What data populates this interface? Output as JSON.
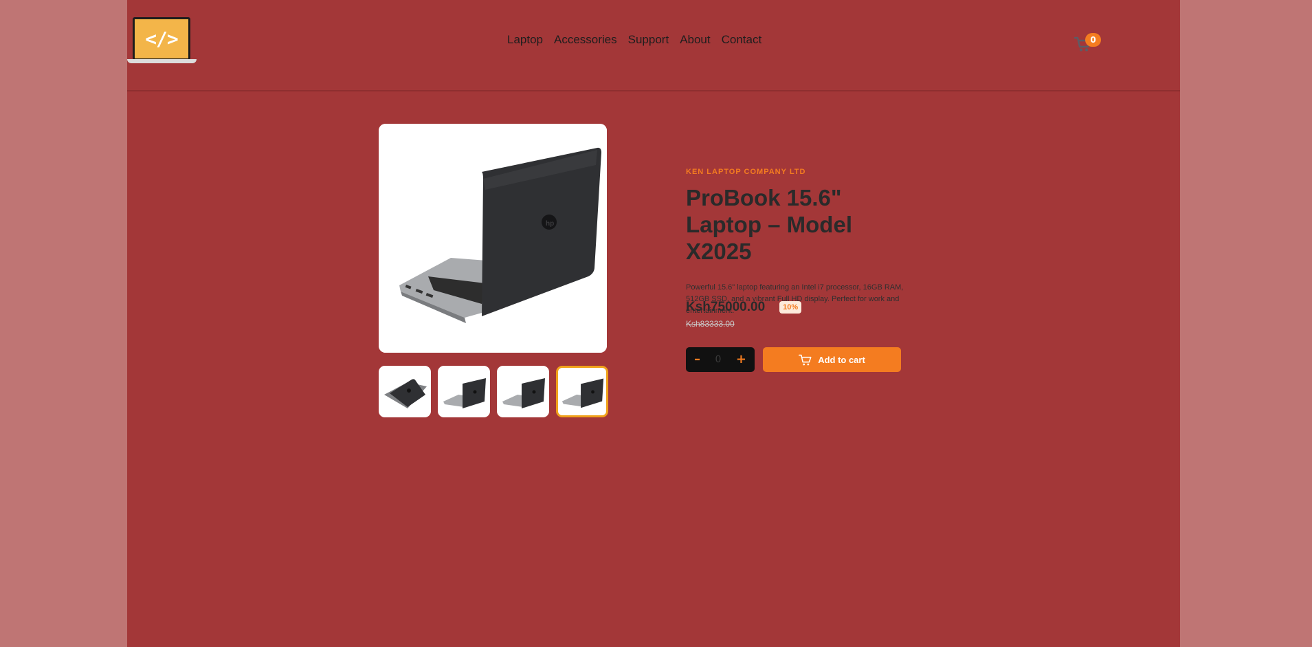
{
  "logo": {
    "glyph": "</>"
  },
  "nav": {
    "items": [
      "Laptop",
      "Accessories",
      "Support",
      "About",
      "Contact"
    ]
  },
  "cart": {
    "count": "0",
    "icon": "cart-icon"
  },
  "product": {
    "company": "KEN LAPTOP COMPANY LTD",
    "title": "ProBook 15.6\" Laptop – Model X2025",
    "description": "Powerful 15.6\" laptop featuring an Intel i7 processor, 16GB RAM, 512GB SSD, and a vibrant Full HD display. Perfect for work and entertainment.",
    "price": "Ksh75000.00",
    "discount": "10%",
    "old_price": "Ksh83333.00",
    "quantity": "0",
    "minus_label": "–",
    "plus_label": "+",
    "add_to_cart_label": "Add to cart",
    "thumbnail_count": 4,
    "active_thumbnail": 4
  },
  "colors": {
    "background": "#bf7574",
    "page": "#a33738",
    "accent": "#f47c20",
    "logo": "#f3b549",
    "active_thumb_border": "#f0a11a"
  }
}
